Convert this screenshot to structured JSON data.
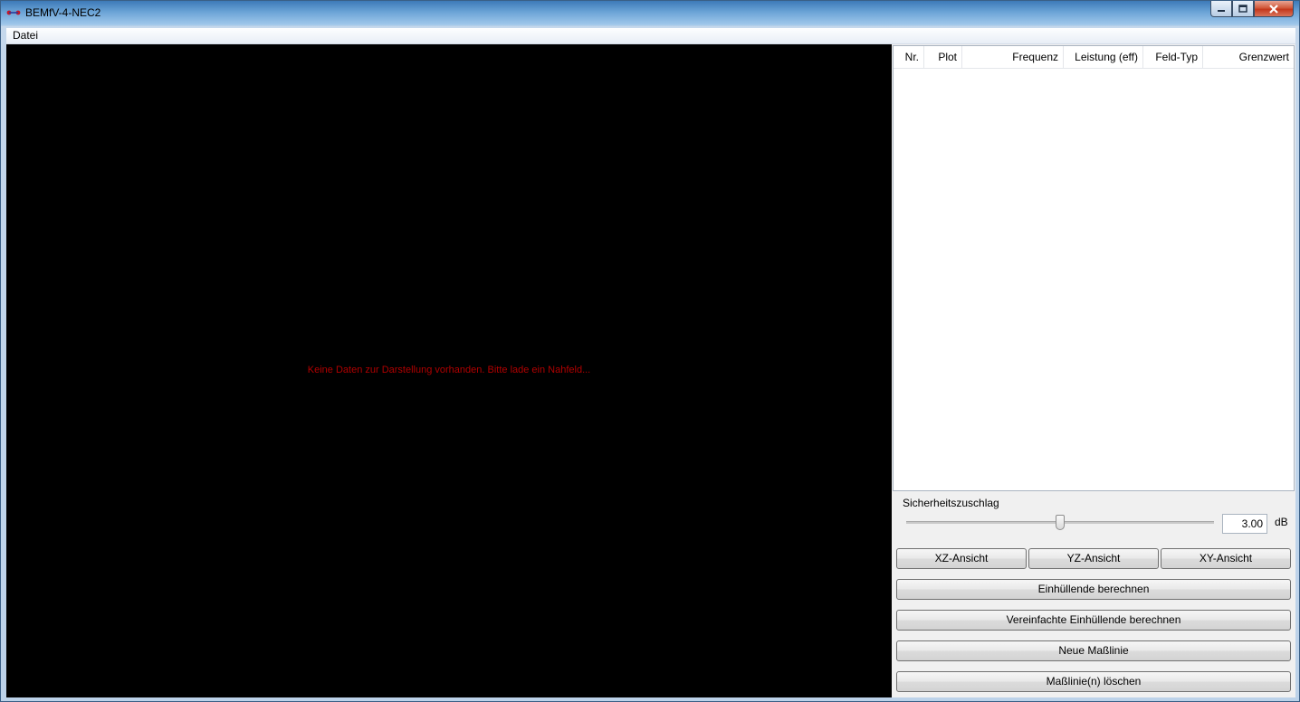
{
  "window": {
    "title": "BEMfV-4-NEC2"
  },
  "menu": {
    "file": "Datei"
  },
  "canvas": {
    "message": "Keine Daten zur Darstellung vorhanden. Bitte lade ein Nahfeld..."
  },
  "table": {
    "columns": [
      "Nr.",
      "Plot",
      "Frequenz",
      "Leistung (eff)",
      "Feld-Typ",
      "Grenzwert"
    ]
  },
  "safety": {
    "label": "Sicherheitszuschlag",
    "value": "3.00",
    "unit": "dB",
    "slider_fraction": 0.5
  },
  "buttons": {
    "xz": "XZ-Ansicht",
    "yz": "YZ-Ansicht",
    "xy": "XY-Ansicht",
    "envelope": "Einhüllende berechnen",
    "simplified_envelope": "Vereinfachte Einhüllende berechnen",
    "new_line": "Neue Maßlinie",
    "delete_lines": "Maßlinie(n) löschen"
  }
}
